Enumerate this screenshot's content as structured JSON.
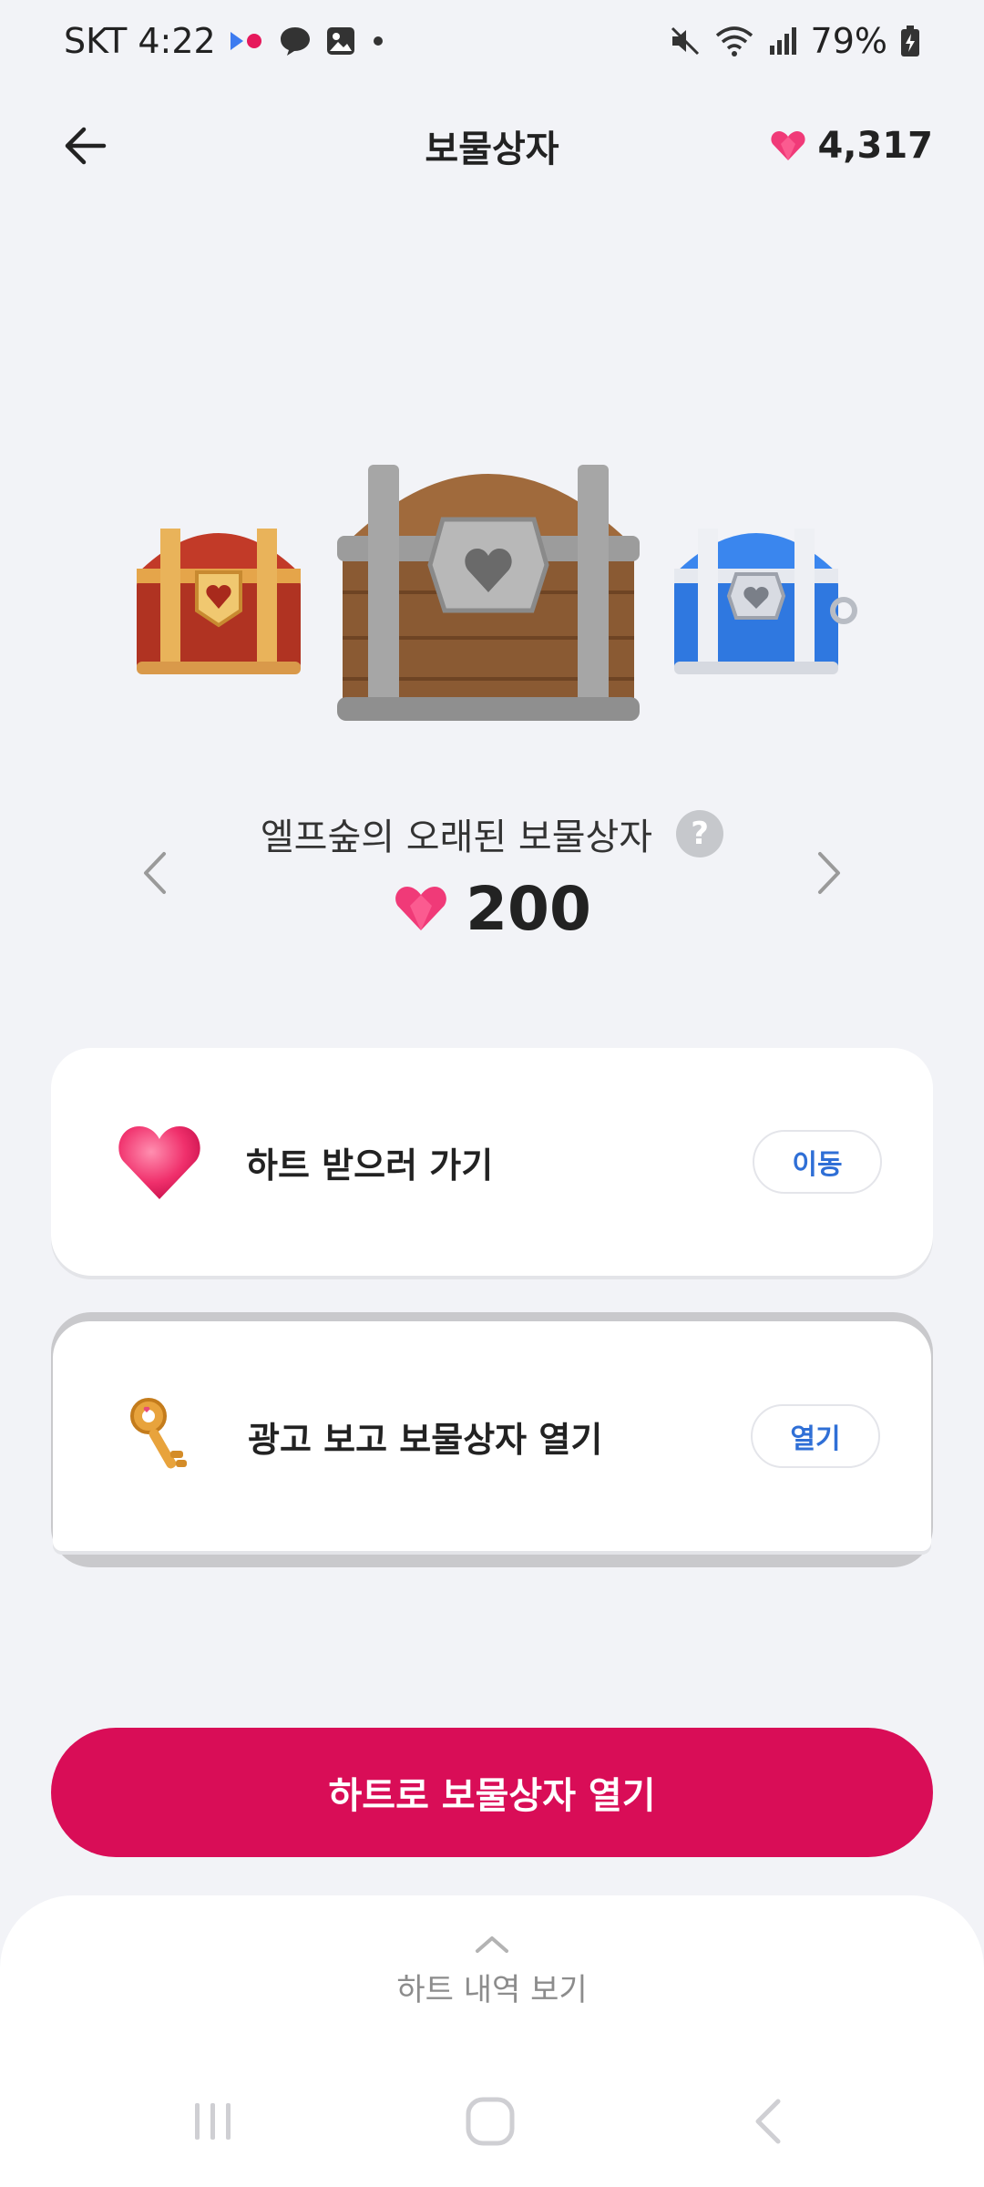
{
  "status_bar": {
    "carrier_time": "SKT 4:22",
    "battery": "79%"
  },
  "header": {
    "title": "보물상자",
    "heart_balance": "4,317"
  },
  "chest": {
    "name": "엘프숲의 오래된 보물상자",
    "help": "?",
    "price": "200"
  },
  "cards": [
    {
      "label": "하트 받으러 가기",
      "button": "이동",
      "icon": "heart-icon"
    },
    {
      "label": "광고 보고 보물상자 열기",
      "button": "열기",
      "icon": "key-icon"
    }
  ],
  "cta": {
    "label": "하트로 보물상자 열기"
  },
  "sheet": {
    "label": "하트 내역 보기"
  },
  "colors": {
    "accent": "#d90d57",
    "button_text": "#2f6fd6",
    "background": "#f2f3f7"
  }
}
